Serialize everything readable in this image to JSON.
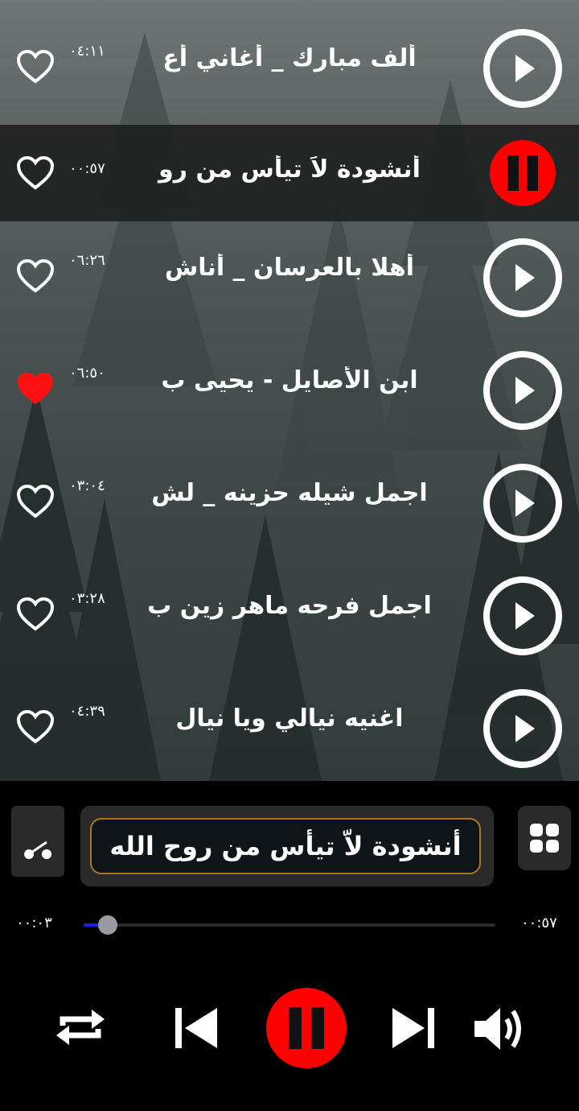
{
  "colors": {
    "accent_red": "#ff0000",
    "progress_blue": "#1a22d8",
    "frame_gold": "#a8781c"
  },
  "tracks": [
    {
      "title": "ألف مبارك _ أغاني أع",
      "duration": "٠٤:١١",
      "liked": false,
      "playing": false
    },
    {
      "title": "أنشودة لاَ تيأس من رو",
      "duration": "٠٠:٥٧",
      "liked": false,
      "playing": true
    },
    {
      "title": "أهلا بالعرسان _ أناش",
      "duration": "٠٦:٢٦",
      "liked": false,
      "playing": false
    },
    {
      "title": "ابن الأصايل - يحيى ب",
      "duration": "٠٦:٥٠",
      "liked": true,
      "playing": false
    },
    {
      "title": "اجمل شيله حزينه _ لش",
      "duration": "٠٣:٠٤",
      "liked": false,
      "playing": false
    },
    {
      "title": "اجمل فرحه ماهر زين ب",
      "duration": "٠٣:٢٨",
      "liked": false,
      "playing": false
    },
    {
      "title": "اغنيه نيالي ويا نيال",
      "duration": "٠٤:٣٩",
      "liked": false,
      "playing": false
    }
  ],
  "player": {
    "now_playing": "أنشودة لاّ تيأس من روح الله",
    "current_time": "٠٠:٠٣",
    "total_time": "٠٠:٥٧",
    "progress_fraction": 0.058,
    "is_playing": true
  },
  "icons": {
    "share": "share-icon",
    "menu": "grid-icon",
    "repeat": "repeat-icon",
    "previous": "skip-previous-icon",
    "pause": "pause-icon",
    "next": "skip-next-icon",
    "volume": "volume-icon"
  }
}
